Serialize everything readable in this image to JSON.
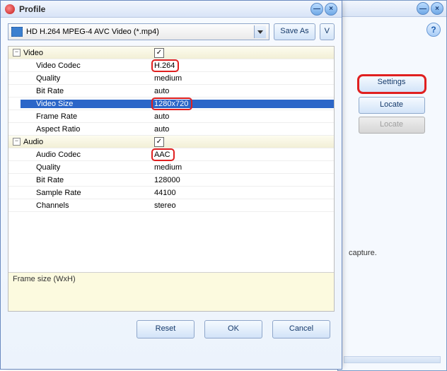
{
  "bg": {
    "help_icon": "?",
    "min_icon": "—",
    "close_icon": "×",
    "settings_btn": "Settings",
    "locate_btn": "Locate",
    "locate_disabled_btn": "Locate",
    "text": "capture."
  },
  "profile": {
    "title": "Profile",
    "min_icon": "—",
    "close_icon": "×",
    "select_value": "HD H.264 MPEG-4 AVC Video (*.mp4)",
    "save_as_btn": "Save As",
    "v_btn": "V",
    "groups": [
      {
        "expander": "−",
        "name": "Video",
        "rows": [
          {
            "name": "Video Codec",
            "value": "H.264",
            "red": true
          },
          {
            "name": "Quality",
            "value": "medium"
          },
          {
            "name": "Bit Rate",
            "value": "auto"
          },
          {
            "name": "Video Size",
            "value": "1280x720",
            "selected": true,
            "red": true
          },
          {
            "name": "Frame Rate",
            "value": "auto"
          },
          {
            "name": "Aspect Ratio",
            "value": "auto"
          }
        ]
      },
      {
        "expander": "−",
        "name": "Audio",
        "rows": [
          {
            "name": "Audio Codec",
            "value": "AAC",
            "red": true
          },
          {
            "name": "Quality",
            "value": "medium"
          },
          {
            "name": "Bit Rate",
            "value": "128000"
          },
          {
            "name": "Sample Rate",
            "value": "44100"
          },
          {
            "name": "Channels",
            "value": "stereo"
          }
        ]
      }
    ],
    "description": "Frame size (WxH)",
    "reset_btn": "Reset",
    "ok_btn": "OK",
    "cancel_btn": "Cancel",
    "check_mark": "✓"
  }
}
